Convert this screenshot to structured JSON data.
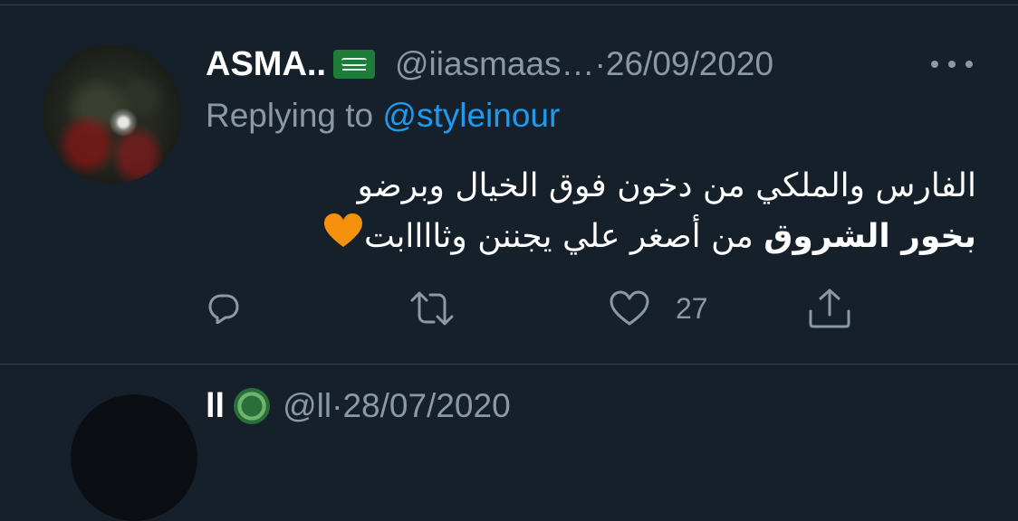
{
  "tweet": {
    "display_name": "ASMA..",
    "flag_emoji": "saudi-arabia-flag",
    "handle": "@iiasmaas…",
    "date_separator": " · ",
    "date": "26/09/2020",
    "replying_prefix": "Replying to ",
    "replying_to": "@styleinour",
    "text_line1": "الفارس والملكي من دخون فوق الخيال وبرضو",
    "text_bold": "بخور الشروق",
    "text_line2_rest": " من أصغر علي يجننن وثاااابت",
    "trailing_emoji": "orange-heart",
    "like_count": "27"
  },
  "next_tweet": {
    "display_name": "ll",
    "handle": "@ll",
    "date_separator": " · ",
    "date": "28/07/2020"
  },
  "colors": {
    "background": "#15202b",
    "secondary_text": "#8b98a5",
    "link": "#1d9bf0",
    "divider": "#38444d"
  }
}
